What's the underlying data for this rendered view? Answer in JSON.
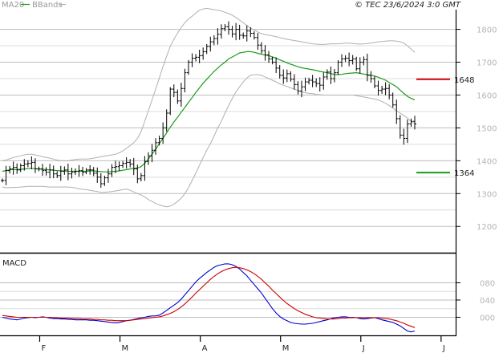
{
  "header": {
    "legend": [
      {
        "label": "MA20",
        "color": "#1a9b1a"
      },
      {
        "label": "BBands",
        "color": "#b0b0b0"
      }
    ],
    "copyright": "© TEC 23/6/2024 3:0 GMT"
  },
  "chart_data": [
    {
      "type": "line",
      "panel": "price",
      "x_labels": [
        "F",
        "M",
        "A",
        "M",
        "J",
        "J"
      ],
      "y_ticks": [
        1200,
        1300,
        1400,
        1500,
        1600,
        1700,
        1800
      ],
      "ylim": [
        1120,
        1860
      ],
      "grid": true,
      "colors": {
        "ma": "#1a9b1a",
        "bands": "#b0b0b0",
        "bars": "#000000",
        "resistance": "#cc0000",
        "support": "#1a9b1a"
      },
      "markers": [
        {
          "name": "resistance",
          "value": 1648,
          "label": "1648"
        },
        {
          "name": "support",
          "value": 1364,
          "label": "1364"
        }
      ],
      "ohlc_close": [
        1340,
        1370,
        1375,
        1380,
        1372,
        1385,
        1390,
        1392,
        1395,
        1375,
        1375,
        1370,
        1365,
        1372,
        1360,
        1355,
        1368,
        1372,
        1360,
        1365,
        1368,
        1370,
        1365,
        1372,
        1372,
        1362,
        1350,
        1330,
        1348,
        1360,
        1380,
        1382,
        1385,
        1392,
        1395,
        1390,
        1375,
        1345,
        1355,
        1398,
        1415,
        1432,
        1455,
        1468,
        1500,
        1545,
        1618,
        1608,
        1582,
        1620,
        1668,
        1700,
        1712,
        1715,
        1720,
        1732,
        1748,
        1762,
        1772,
        1785,
        1802,
        1808,
        1800,
        1786,
        1800,
        1782,
        1780,
        1795,
        1788,
        1775,
        1752,
        1735,
        1722,
        1710,
        1700,
        1682,
        1660,
        1652,
        1665,
        1648,
        1632,
        1612,
        1625,
        1640,
        1645,
        1640,
        1635,
        1630,
        1655,
        1670,
        1650,
        1668,
        1700,
        1710,
        1712,
        1705,
        1710,
        1680,
        1700,
        1708,
        1660,
        1650,
        1628,
        1614,
        1618,
        1620,
        1600,
        1570,
        1528,
        1478,
        1468,
        1512,
        1520,
        1512
      ],
      "series": [
        {
          "name": "MA20",
          "values": [
            1368,
            1370,
            1372,
            1374,
            1373,
            1374,
            1375,
            1376,
            1377,
            1376,
            1375,
            1374,
            1373,
            1372,
            1371,
            1370,
            1369,
            1369,
            1368,
            1368,
            1368,
            1368,
            1368,
            1368,
            1369,
            1369,
            1368,
            1367,
            1366,
            1366,
            1367,
            1368,
            1369,
            1371,
            1373,
            1375,
            1377,
            1378,
            1382,
            1392,
            1405,
            1420,
            1435,
            1452,
            1468,
            1485,
            1502,
            1518,
            1532,
            1548,
            1562,
            1578,
            1592,
            1608,
            1622,
            1636,
            1648,
            1660,
            1672,
            1682,
            1692,
            1700,
            1710,
            1716,
            1722,
            1728,
            1730,
            1732,
            1732,
            1730,
            1727,
            1724,
            1722,
            1720,
            1716,
            1712,
            1707,
            1703,
            1698,
            1694,
            1690,
            1686,
            1683,
            1681,
            1679,
            1677,
            1675,
            1672,
            1670,
            1668,
            1665,
            1663,
            1662,
            1663,
            1665,
            1666,
            1667,
            1668,
            1666,
            1664,
            1662,
            1660,
            1658,
            1654,
            1650,
            1645,
            1638,
            1632,
            1625,
            1615,
            1605,
            1596,
            1590,
            1585
          ]
        },
        {
          "name": "BB upper",
          "values": [
            1400,
            1402,
            1406,
            1410,
            1412,
            1415,
            1418,
            1420,
            1420,
            1418,
            1415,
            1412,
            1410,
            1408,
            1405,
            1402,
            1400,
            1400,
            1400,
            1402,
            1404,
            1405,
            1405,
            1405,
            1406,
            1408,
            1410,
            1412,
            1414,
            1416,
            1418,
            1420,
            1424,
            1430,
            1438,
            1446,
            1455,
            1468,
            1488,
            1520,
            1552,
            1585,
            1618,
            1652,
            1686,
            1718,
            1748,
            1770,
            1788,
            1806,
            1820,
            1832,
            1840,
            1850,
            1858,
            1862,
            1864,
            1862,
            1860,
            1858,
            1856,
            1852,
            1848,
            1843,
            1836,
            1828,
            1820,
            1812,
            1804,
            1798,
            1792,
            1787,
            1784,
            1782,
            1780,
            1778,
            1775,
            1772,
            1770,
            1768,
            1766,
            1764,
            1762,
            1760,
            1758,
            1756,
            1755,
            1754,
            1754,
            1755,
            1756,
            1756,
            1756,
            1757,
            1758,
            1758,
            1757,
            1756,
            1755,
            1756,
            1757,
            1758,
            1760,
            1762,
            1763,
            1764,
            1765,
            1765,
            1764,
            1762,
            1758,
            1750,
            1740,
            1730
          ]
        },
        {
          "name": "BB lower",
          "values": [
            1320,
            1318,
            1318,
            1319,
            1319,
            1320,
            1321,
            1322,
            1322,
            1322,
            1322,
            1322,
            1321,
            1320,
            1320,
            1320,
            1320,
            1320,
            1320,
            1319,
            1317,
            1315,
            1313,
            1312,
            1310,
            1308,
            1306,
            1304,
            1304,
            1305,
            1306,
            1308,
            1310,
            1312,
            1314,
            1310,
            1305,
            1300,
            1296,
            1290,
            1282,
            1276,
            1270,
            1266,
            1262,
            1260,
            1262,
            1268,
            1276,
            1286,
            1300,
            1318,
            1340,
            1362,
            1386,
            1410,
            1432,
            1452,
            1475,
            1500,
            1520,
            1545,
            1568,
            1590,
            1610,
            1625,
            1640,
            1652,
            1660,
            1662,
            1662,
            1660,
            1655,
            1650,
            1645,
            1640,
            1634,
            1630,
            1626,
            1622,
            1618,
            1614,
            1610,
            1607,
            1605,
            1604,
            1602,
            1601,
            1600,
            1600,
            1600,
            1600,
            1600,
            1600,
            1600,
            1600,
            1600,
            1598,
            1596,
            1594,
            1592,
            1590,
            1588,
            1585,
            1580,
            1575,
            1568,
            1560,
            1552,
            1545,
            1538,
            1530,
            1520,
            1512
          ]
        }
      ]
    },
    {
      "type": "line",
      "panel": "macd",
      "title": "MACD",
      "y_ticks": [
        0,
        40,
        80
      ],
      "ylim": [
        -42,
        148
      ],
      "grid": true,
      "series": [
        {
          "name": "MACD",
          "color": "#0000cc",
          "values": [
            0,
            -2,
            -4,
            -5,
            -6,
            -4,
            -2,
            -1,
            0,
            -1,
            0,
            1,
            0,
            -2,
            -3,
            -3,
            -4,
            -4,
            -5,
            -5,
            -6,
            -6,
            -6,
            -6,
            -7,
            -7,
            -8,
            -9,
            -10,
            -11,
            -12,
            -13,
            -12,
            -10,
            -8,
            -7,
            -5,
            -3,
            -1,
            0,
            2,
            3,
            3,
            5,
            10,
            16,
            22,
            28,
            34,
            42,
            52,
            62,
            72,
            82,
            90,
            97,
            104,
            110,
            116,
            120,
            122,
            124,
            124,
            122,
            118,
            112,
            104,
            96,
            86,
            76,
            66,
            56,
            44,
            32,
            20,
            10,
            2,
            -4,
            -8,
            -12,
            -14,
            -15,
            -16,
            -16,
            -15,
            -14,
            -12,
            -10,
            -8,
            -6,
            -3,
            -1,
            0,
            1,
            1,
            0,
            0,
            -1,
            -3,
            -4,
            -3,
            -2,
            -1,
            -3,
            -6,
            -8,
            -10,
            -12,
            -16,
            -20,
            -26,
            -32,
            -34,
            -32
          ]
        },
        {
          "name": "Signal",
          "color": "#cc0000",
          "values": [
            4,
            3,
            2,
            1,
            0,
            0,
            0,
            0,
            0,
            0,
            0,
            0,
            0,
            0,
            -1,
            -1,
            -2,
            -2,
            -2,
            -3,
            -3,
            -3,
            -4,
            -4,
            -4,
            -5,
            -5,
            -6,
            -6,
            -7,
            -7,
            -8,
            -8,
            -8,
            -8,
            -7,
            -6,
            -5,
            -4,
            -3,
            -2,
            -1,
            0,
            1,
            3,
            6,
            9,
            13,
            18,
            24,
            31,
            39,
            47,
            56,
            64,
            72,
            80,
            88,
            95,
            101,
            106,
            110,
            113,
            115,
            116,
            115,
            113,
            110,
            106,
            101,
            95,
            88,
            80,
            72,
            63,
            55,
            47,
            39,
            32,
            26,
            20,
            15,
            11,
            7,
            4,
            1,
            -1,
            -2,
            -3,
            -4,
            -4,
            -4,
            -3,
            -2,
            -2,
            -1,
            -1,
            -1,
            -1,
            -1,
            -1,
            -1,
            -1,
            -1,
            -2,
            -3,
            -4,
            -6,
            -8,
            -11,
            -14,
            -18,
            -21,
            -24
          ]
        }
      ]
    }
  ]
}
